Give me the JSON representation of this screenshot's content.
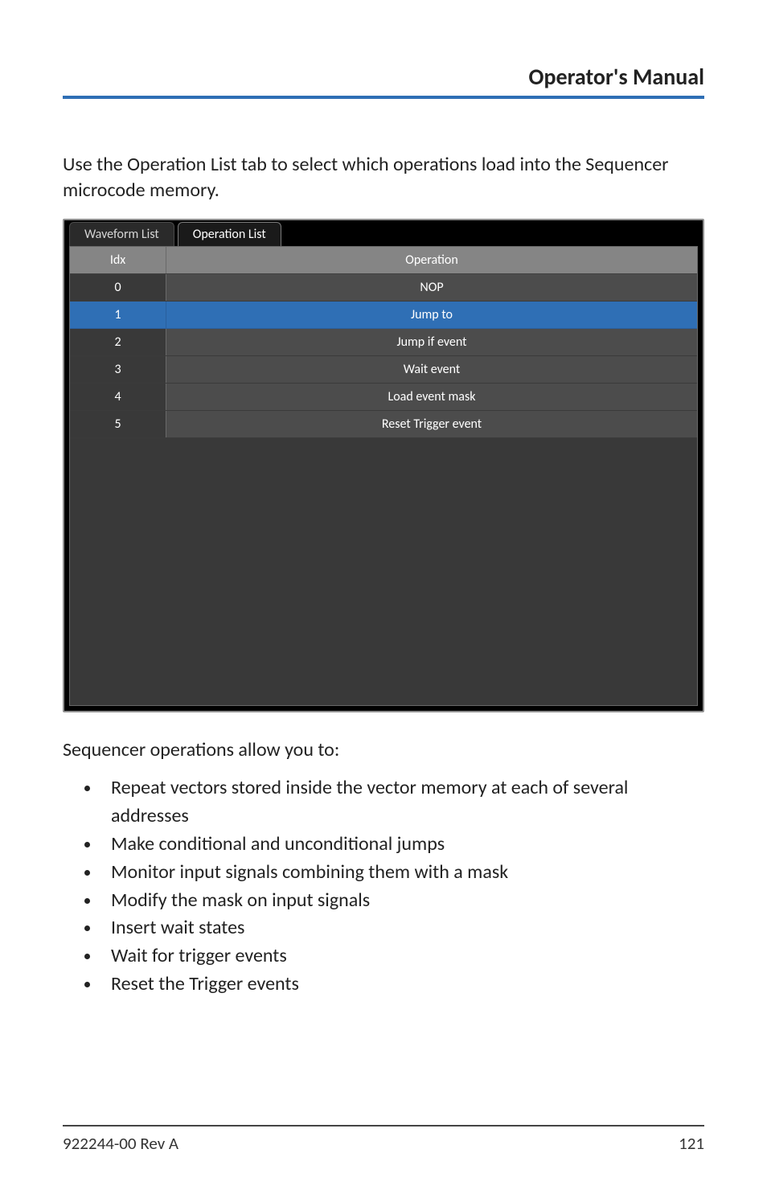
{
  "header": {
    "title": "Operator's Manual"
  },
  "intro": "Use the Operation List tab to select which operations load into the Sequencer microcode memory.",
  "tabs": {
    "inactive": "Waveform List",
    "active": "Operation List"
  },
  "table": {
    "headers": {
      "idx": "Idx",
      "op": "Operation"
    },
    "rows": [
      {
        "idx": "0",
        "op": "NOP",
        "selected": false
      },
      {
        "idx": "1",
        "op": "Jump to",
        "selected": true
      },
      {
        "idx": "2",
        "op": "Jump if event",
        "selected": false
      },
      {
        "idx": "3",
        "op": "Wait event",
        "selected": false
      },
      {
        "idx": "4",
        "op": "Load event mask",
        "selected": false
      },
      {
        "idx": "5",
        "op": "Reset Trigger event",
        "selected": false
      }
    ]
  },
  "after_intro": "Sequencer operations allow you to:",
  "bullets": [
    "Repeat vectors stored inside the vector memory at each of several addresses",
    "Make conditional and unconditional jumps",
    "Monitor input signals combining them with a mask",
    "Modify the mask on input signals",
    "Insert wait states",
    "Wait for trigger events",
    "Reset the Trigger events"
  ],
  "footer": {
    "left": "922244-00 Rev A",
    "right": "121"
  }
}
